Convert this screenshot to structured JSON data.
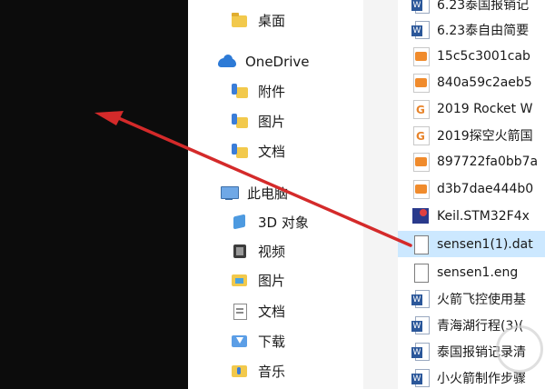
{
  "nav": {
    "desktop": "桌面",
    "onedrive": "OneDrive",
    "attachments": "附件",
    "pictures_od": "图片",
    "documents_od": "文档",
    "this_pc": "此电脑",
    "objects3d": "3D 对象",
    "videos": "视频",
    "pictures": "图片",
    "documents": "文档",
    "downloads": "下载",
    "music": "音乐"
  },
  "files": [
    {
      "name": "6.23泰国报销记",
      "icon": "word-icon"
    },
    {
      "name": "6.23泰自由简要",
      "icon": "word-icon"
    },
    {
      "name": "15c5c3001cab",
      "icon": "image-file-icon"
    },
    {
      "name": "840a59c2aeb5",
      "icon": "image-file-icon"
    },
    {
      "name": "2019 Rocket W",
      "icon": "gcode-file-icon"
    },
    {
      "name": "2019探空火箭国",
      "icon": "gcode-file-icon"
    },
    {
      "name": "897722fa0bb7a",
      "icon": "image-file-icon"
    },
    {
      "name": "d3b7dae444b0",
      "icon": "image-file-icon"
    },
    {
      "name": "Keil.STM32F4x",
      "icon": "keil-package-icon"
    },
    {
      "name": "sensen1(1).dat",
      "icon": "blank-file-icon",
      "selected": true
    },
    {
      "name": "sensen1.eng",
      "icon": "blank-file-icon"
    },
    {
      "name": "火箭飞控使用基",
      "icon": "word-icon"
    },
    {
      "name": "青海湖行程(3)(",
      "icon": "word-icon"
    },
    {
      "name": "泰国报销记录清",
      "icon": "word-icon"
    },
    {
      "name": "小火箭制作步骤",
      "icon": "word-icon"
    }
  ],
  "colors": {
    "selection": "#cce8ff",
    "arrow": "#d42a2a"
  }
}
